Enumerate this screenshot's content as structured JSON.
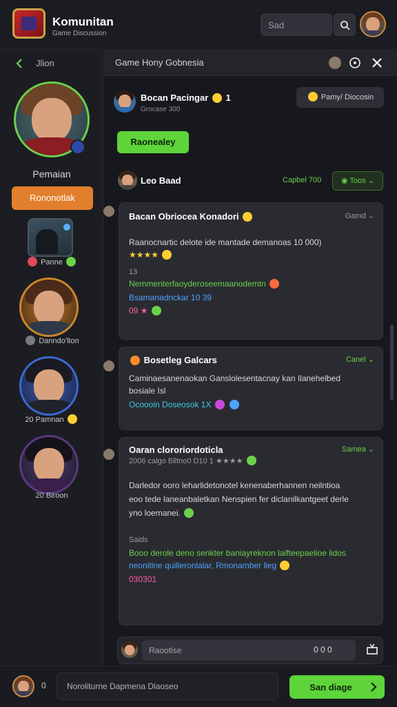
{
  "header": {
    "brand": "Komunitan",
    "brand_sub": "Game Discussion",
    "search_placeholder": "Sad",
    "icons": [
      "app-logo",
      "search-icon",
      "user-avatar"
    ]
  },
  "left_panel": {
    "title": "Jlion",
    "profile_name": "Pemaian",
    "follow_label": "Rononotlak",
    "friends": [
      {
        "label": "Panne"
      },
      {
        "label": "Danndo'lton"
      },
      {
        "label": "Pamnan",
        "prefix": "20"
      },
      {
        "label": "Biroon",
        "prefix": "20"
      }
    ]
  },
  "chat": {
    "title": "Game Hony Gobnesia",
    "host_name": "Bocan Pacingar",
    "host_count": "1",
    "host_sub": "Grocase 300",
    "tag_label": "Pamy/ Diocosin",
    "green_button": "Raonealey",
    "row2_name": "Leo Baad",
    "row2_status": "Capbel 700",
    "row2_pill": "Toos",
    "posts": [
      {
        "title": "Bacan Obriocea Konadori",
        "meta": "Gamd",
        "lines": [
          "Raanocnartic delote ide mantade demanoas 10 000)",
          "★★★★",
          "13",
          "Nemmenterfaoyderoseemaanodemtn",
          "Bsamanadnckar  10  39",
          "09 ★"
        ]
      },
      {
        "title": "Bosetleg Galcars",
        "meta": "Canel",
        "lines": [
          "Caminaesanenaokan Ganslolesentacnay kan Ilanehelbed",
          "bosiale Isl",
          "Ocoooin  Doseosok  1X"
        ]
      },
      {
        "title": "Oaran clororiordoticla",
        "meta": "Samea",
        "lines": [
          "2006 calgo Blltno0 D10 1  ★★★★",
          "Darledor ooro leharlidetonotel kenenaberhannen neilntioa",
          "eoo tede laneanbaletkan Nenspien fer diclanilkantgeet derle",
          "yno loemanei.",
          "Saids",
          "Booo derole deno senkter baniayreknon  laifteepaelioe lidos",
          "neonitine quilleronlalar, Rmonamber lieg",
          "030301"
        ]
      }
    ]
  },
  "composer": {
    "placeholder": "Raootise",
    "count": "0 0 0"
  },
  "bottom": {
    "count": "0",
    "input_placeholder": "Noroliturne Dapmena Dlaoseo",
    "send_label": "San diage"
  },
  "colors": {
    "accent_green": "#5ed43a",
    "accent_orange": "#e27f2c",
    "background": "#17181d",
    "card": "#2a2b31"
  }
}
